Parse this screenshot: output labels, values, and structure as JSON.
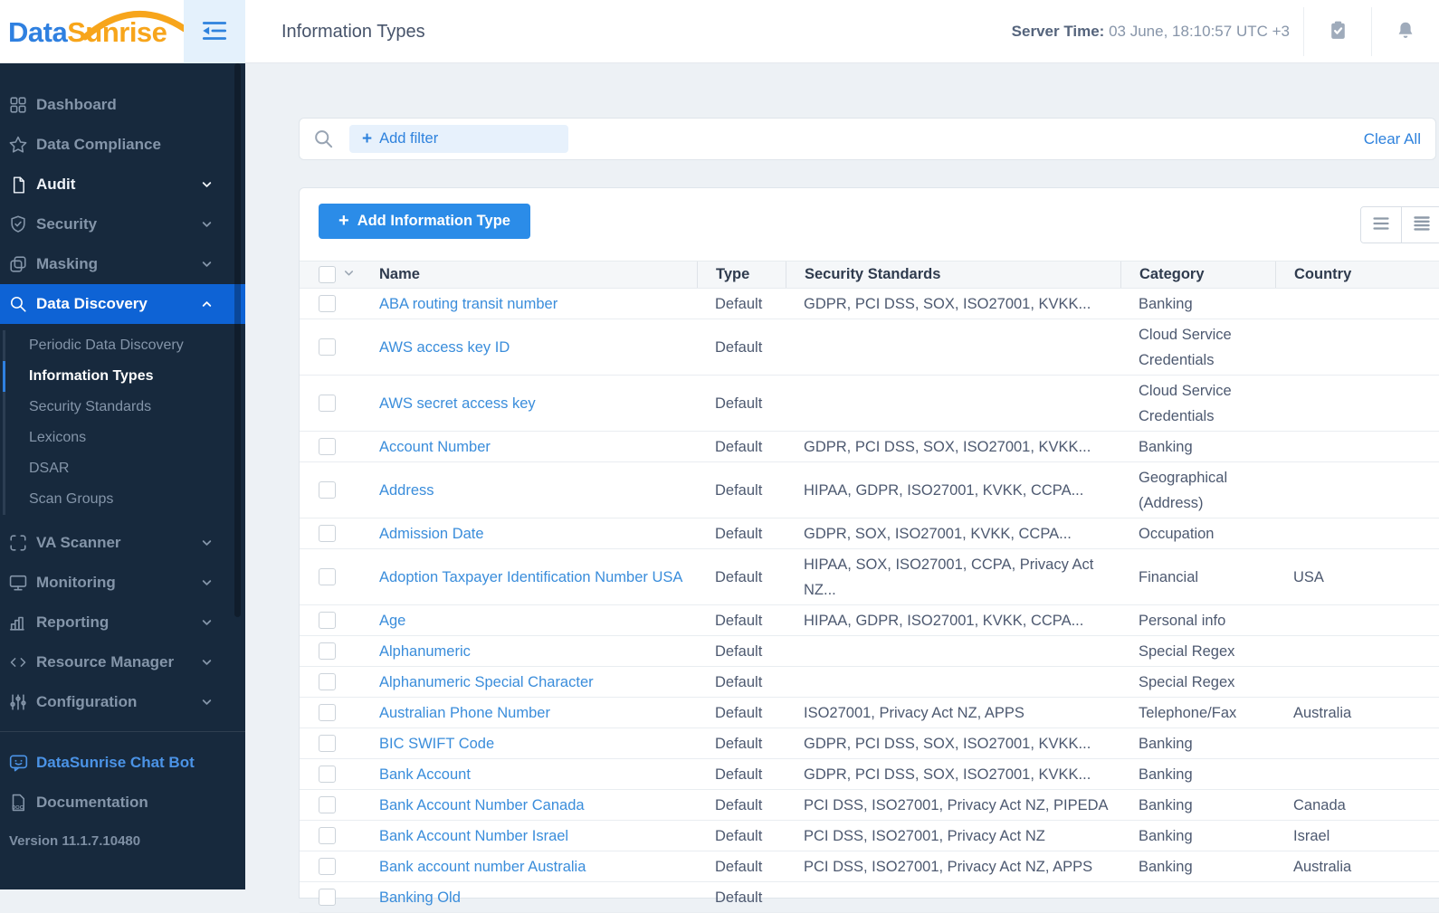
{
  "brand": {
    "name_primary": "Data",
    "name_secondary": "Sunrise",
    "primary_color": "#2f80e0",
    "secondary_color": "#f7a51b"
  },
  "header": {
    "title": "Information Types",
    "server_time_label": "Server Time:",
    "server_time_value": "03 June, 18:10:57",
    "server_time_zone": "UTC +3"
  },
  "sidebar": {
    "menu": [
      {
        "label": "Dashboard",
        "icon": "grid-icon",
        "expandable": false,
        "state": "normal"
      },
      {
        "label": "Data Compliance",
        "icon": "star-icon",
        "expandable": false,
        "state": "normal"
      },
      {
        "label": "Audit",
        "icon": "document-icon",
        "expandable": true,
        "state": "bright"
      },
      {
        "label": "Security",
        "icon": "shield-icon",
        "expandable": true,
        "state": "normal"
      },
      {
        "label": "Masking",
        "icon": "masking-icon",
        "expandable": true,
        "state": "normal"
      },
      {
        "label": "Data Discovery",
        "icon": "search-icon",
        "expandable": true,
        "expanded": true,
        "state": "active",
        "children": [
          {
            "label": "Periodic Data Discovery",
            "state": "normal"
          },
          {
            "label": "Information Types",
            "state": "active"
          },
          {
            "label": "Security Standards",
            "state": "normal"
          },
          {
            "label": "Lexicons",
            "state": "normal"
          },
          {
            "label": "DSAR",
            "state": "normal"
          },
          {
            "label": "Scan Groups",
            "state": "normal"
          }
        ]
      },
      {
        "label": "VA Scanner",
        "icon": "scanner-icon",
        "expandable": true,
        "state": "normal"
      },
      {
        "label": "Monitoring",
        "icon": "monitor-icon",
        "expandable": true,
        "state": "normal"
      },
      {
        "label": "Reporting",
        "icon": "bar-chart-icon",
        "expandable": true,
        "state": "normal"
      },
      {
        "label": "Resource Manager",
        "icon": "code-icon",
        "expandable": true,
        "state": "normal"
      },
      {
        "label": "Configuration",
        "icon": "sliders-icon",
        "expandable": true,
        "state": "normal"
      }
    ],
    "extra": [
      {
        "label": "DataSunrise Chat Bot",
        "icon": "chat-bot-icon",
        "state": "accent"
      },
      {
        "label": "Documentation",
        "icon": "doc-icon",
        "state": "normal"
      }
    ],
    "version": "Version 11.1.7.10480"
  },
  "filter_bar": {
    "add_filter_label": "Add filter",
    "clear_all_label": "Clear All"
  },
  "toolbar": {
    "add_information_type_label": "Add Information Type"
  },
  "table": {
    "columns": [
      "Name",
      "Type",
      "Security Standards",
      "Category",
      "Country"
    ],
    "rows": [
      {
        "name": "ABA routing transit number",
        "type": "Default",
        "standards": "GDPR, PCI DSS, SOX, ISO27001, KVKK...",
        "category": "Banking",
        "country": ""
      },
      {
        "name": "AWS access key ID",
        "type": "Default",
        "standards": "",
        "category": "Cloud Service Credentials",
        "country": ""
      },
      {
        "name": "AWS secret access key",
        "type": "Default",
        "standards": "",
        "category": "Cloud Service Credentials",
        "country": ""
      },
      {
        "name": "Account Number",
        "type": "Default",
        "standards": "GDPR, PCI DSS, SOX, ISO27001, KVKK...",
        "category": "Banking",
        "country": ""
      },
      {
        "name": "Address",
        "type": "Default",
        "standards": "HIPAA, GDPR, ISO27001, KVKK, CCPA...",
        "category": "Geographical (Address)",
        "country": ""
      },
      {
        "name": "Admission Date",
        "type": "Default",
        "standards": "GDPR, SOX, ISO27001, KVKK, CCPA...",
        "category": "Occupation",
        "country": ""
      },
      {
        "name": "Adoption Taxpayer Identification Number USA",
        "type": "Default",
        "standards": "HIPAA, SOX, ISO27001, CCPA, Privacy Act NZ...",
        "category": "Financial",
        "country": "USA"
      },
      {
        "name": "Age",
        "type": "Default",
        "standards": "HIPAA, GDPR, ISO27001, KVKK, CCPA...",
        "category": "Personal info",
        "country": ""
      },
      {
        "name": "Alphanumeric",
        "type": "Default",
        "standards": "",
        "category": "Special Regex",
        "country": ""
      },
      {
        "name": "Alphanumeric Special Character",
        "type": "Default",
        "standards": "",
        "category": "Special Regex",
        "country": ""
      },
      {
        "name": "Australian Phone Number",
        "type": "Default",
        "standards": "ISO27001, Privacy Act NZ, APPS",
        "category": "Telephone/Fax",
        "country": "Australia"
      },
      {
        "name": "BIC SWIFT Code",
        "type": "Default",
        "standards": "GDPR, PCI DSS, SOX, ISO27001, KVKK...",
        "category": "Banking",
        "country": ""
      },
      {
        "name": "Bank Account",
        "type": "Default",
        "standards": "GDPR, PCI DSS, SOX, ISO27001, KVKK...",
        "category": "Banking",
        "country": ""
      },
      {
        "name": "Bank Account Number Canada",
        "type": "Default",
        "standards": "PCI DSS, ISO27001, Privacy Act NZ, PIPEDA",
        "category": "Banking",
        "country": "Canada"
      },
      {
        "name": "Bank Account Number Israel",
        "type": "Default",
        "standards": "PCI DSS, ISO27001, Privacy Act NZ",
        "category": "Banking",
        "country": "Israel"
      },
      {
        "name": "Bank account number Australia",
        "type": "Default",
        "standards": "PCI DSS, ISO27001, Privacy Act NZ, APPS",
        "category": "Banking",
        "country": "Australia"
      },
      {
        "name": "Banking Old",
        "type": "Default",
        "standards": "",
        "category": "",
        "country": ""
      }
    ]
  }
}
